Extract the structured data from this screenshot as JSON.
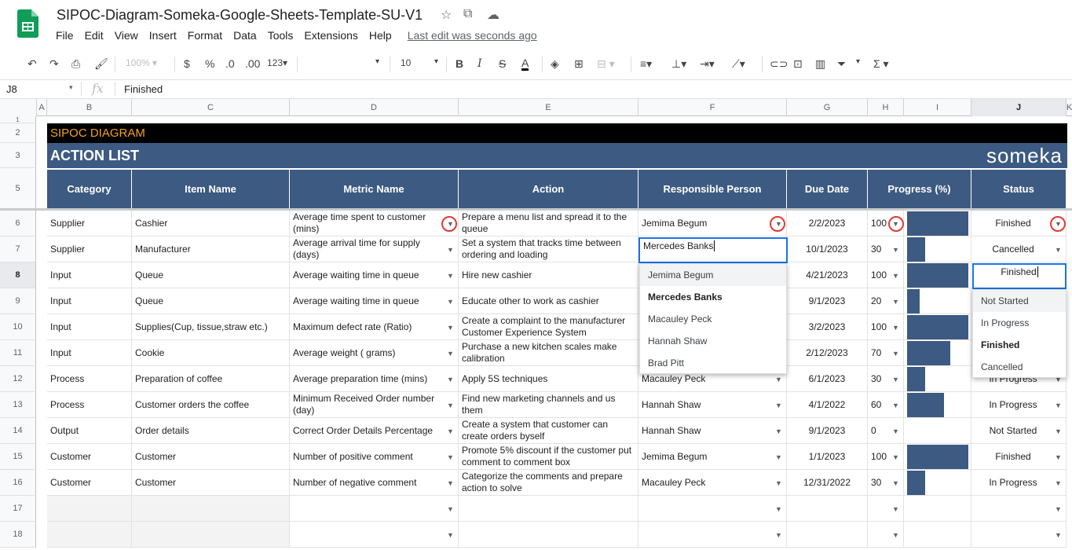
{
  "doc": {
    "title": "SIPOC-Diagram-Someka-Google-Sheets-Template-SU-V1",
    "menus": [
      "File",
      "Edit",
      "View",
      "Insert",
      "Format",
      "Data",
      "Tools",
      "Extensions",
      "Help"
    ],
    "last_edit": "Last edit was seconds ago"
  },
  "toolbar": {
    "zoom": "100%",
    "currency": "$",
    "percent": "%",
    "dec_less": ".0",
    "dec_more": ".00",
    "number_format": "123",
    "font_size": "10",
    "bold": "B",
    "italic": "I",
    "strike": "S",
    "text_color": "A",
    "sum": "Σ"
  },
  "formula_bar": {
    "cell_ref": "J8",
    "fx": "fx",
    "value": "Finished"
  },
  "columns": [
    "A",
    "B",
    "C",
    "D",
    "E",
    "F",
    "G",
    "H",
    "I",
    "J",
    "K"
  ],
  "row_numbers": [
    "1",
    "2",
    "3",
    "5",
    "6",
    "7",
    "8",
    "9",
    "10",
    "11",
    "12",
    "13",
    "14",
    "15",
    "16",
    "17",
    "18"
  ],
  "sheet": {
    "band_title": "SIPOC DIAGRAM",
    "subtitle": "ACTION LIST",
    "brand": "someka",
    "headers": [
      "Category",
      "Item Name",
      "Metric Name",
      "Action",
      "Responsible Person",
      "Due Date",
      "Progress (%)",
      "Status"
    ],
    "rows": [
      {
        "category": "Supplier",
        "item": "Cashier",
        "metric": "Average time spent to customer (mins)",
        "action": "Prepare a menu list and spread it to the queue",
        "person": "Jemima Begum",
        "due": "2/2/2023",
        "progress": "100",
        "status": "Finished"
      },
      {
        "category": "Supplier",
        "item": "Manufacturer",
        "metric": "Average arrival time for supply (days)",
        "action": "Set a system that tracks time between ordering and loading",
        "person": "Mercedes Banks",
        "due": "10/1/2023",
        "progress": "30",
        "status": "Cancelled"
      },
      {
        "category": "Input",
        "item": "Queue",
        "metric": "Average waiting time in queue",
        "action": "Hire new cashier",
        "person": "",
        "due": "4/21/2023",
        "progress": "100",
        "status": "Finished"
      },
      {
        "category": "Input",
        "item": "Queue",
        "metric": "Average waiting time in queue",
        "action": "Educate other to work as cashier",
        "person": "",
        "due": "9/1/2023",
        "progress": "20",
        "status": ""
      },
      {
        "category": "Input",
        "item": "Supplies(Cup, tissue,straw etc.)",
        "metric": "Maximum defect rate (Ratio)",
        "action": "Create a complaint to the manufacturer Customer Experience System",
        "person": "",
        "due": "3/2/2023",
        "progress": "100",
        "status": ""
      },
      {
        "category": "Input",
        "item": "Cookie",
        "metric": "Average weight ( grams)",
        "action": "Purchase a new kitchen scales make calibration",
        "person": "",
        "due": "2/12/2023",
        "progress": "70",
        "status": ""
      },
      {
        "category": "Process",
        "item": "Preparation of coffee",
        "metric": "Average preparation time (mins)",
        "action": "Apply 5S techniques",
        "person": "Macauley Peck",
        "due": "6/1/2023",
        "progress": "30",
        "status": "In Progress"
      },
      {
        "category": "Process",
        "item": "Customer orders the coffee",
        "metric": "Minimum Received Order number (day)",
        "action": "Find new marketing channels and us them",
        "person": "Hannah Shaw",
        "due": "4/1/2022",
        "progress": "60",
        "status": "In Progress"
      },
      {
        "category": "Output",
        "item": "Order details",
        "metric": "Correct Order Details Percentage",
        "action": "Create a system that customer can create orders byself",
        "person": "Hannah Shaw",
        "due": "9/1/2023",
        "progress": "0",
        "status": "Not Started"
      },
      {
        "category": "Customer",
        "item": "Customer",
        "metric": "Number of positive comment",
        "action": "Promote 5% discount if the customer put comment to comment box",
        "person": "Jemima Begum",
        "due": "1/1/2023",
        "progress": "100",
        "status": "Finished"
      },
      {
        "category": "Customer",
        "item": "Customer",
        "metric": "Number of negative comment",
        "action": "Categorize the comments and prepare action to solve",
        "person": "Macauley Peck",
        "due": "12/31/2022",
        "progress": "30",
        "status": "In Progress"
      }
    ]
  },
  "person_dropdown": {
    "options": [
      "Jemima Begum",
      "Mercedes Banks",
      "Macauley Peck",
      "Hannah Shaw",
      "Brad Pitt"
    ],
    "selected": "Mercedes Banks",
    "editing": "Mercedes Banks"
  },
  "status_dropdown": {
    "options": [
      "Not Started",
      "In Progress",
      "Finished",
      "Cancelled"
    ],
    "selected": "Finished",
    "editing": "Finished"
  },
  "colors": {
    "header_blue": "#3c5a82",
    "title_orange": "#f4a21d",
    "band_black": "#000000",
    "highlight_red": "#e53935"
  }
}
